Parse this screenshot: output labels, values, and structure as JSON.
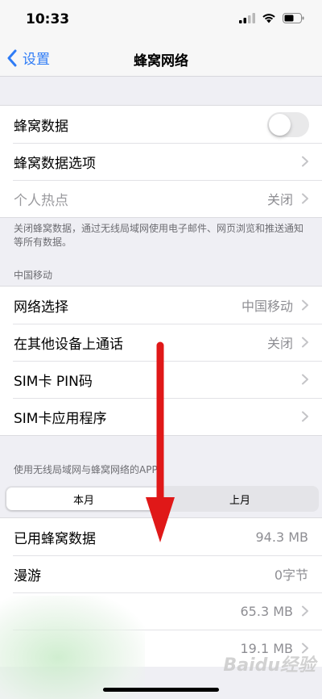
{
  "status_bar": {
    "time": "10:33"
  },
  "nav": {
    "back_label": "设置",
    "title": "蜂窝网络"
  },
  "cellular_group": {
    "toggle_label": "蜂窝数据",
    "toggle_on": false,
    "options_label": "蜂窝数据选项",
    "hotspot_label": "个人热点",
    "hotspot_value": "关闭"
  },
  "footnote": "关闭蜂窝数据，通过无线局域网使用电子邮件、网页浏览和推送通知等所有数据。",
  "carrier_header": "中国移动",
  "carrier_group": {
    "network_label": "网络选择",
    "network_value": "中国移动",
    "calls_label": "在其他设备上通话",
    "calls_value": "关闭",
    "sim_pin_label": "SIM卡 PIN码",
    "sim_app_label": "SIM卡应用程序"
  },
  "apps_header": "使用无线局域网与蜂窝网络的APP",
  "segments": {
    "current": "本月",
    "last": "上月"
  },
  "usage_group": {
    "used_label": "已用蜂窝数据",
    "used_value": "94.3 MB",
    "roaming_label": "漫游",
    "roaming_value": "0字节",
    "app1_value": "65.3 MB",
    "app2_value": "19.1 MB"
  },
  "watermark": "Baidu经验",
  "colors": {
    "accent": "#2f7cf6",
    "arrow": "#e01818"
  }
}
